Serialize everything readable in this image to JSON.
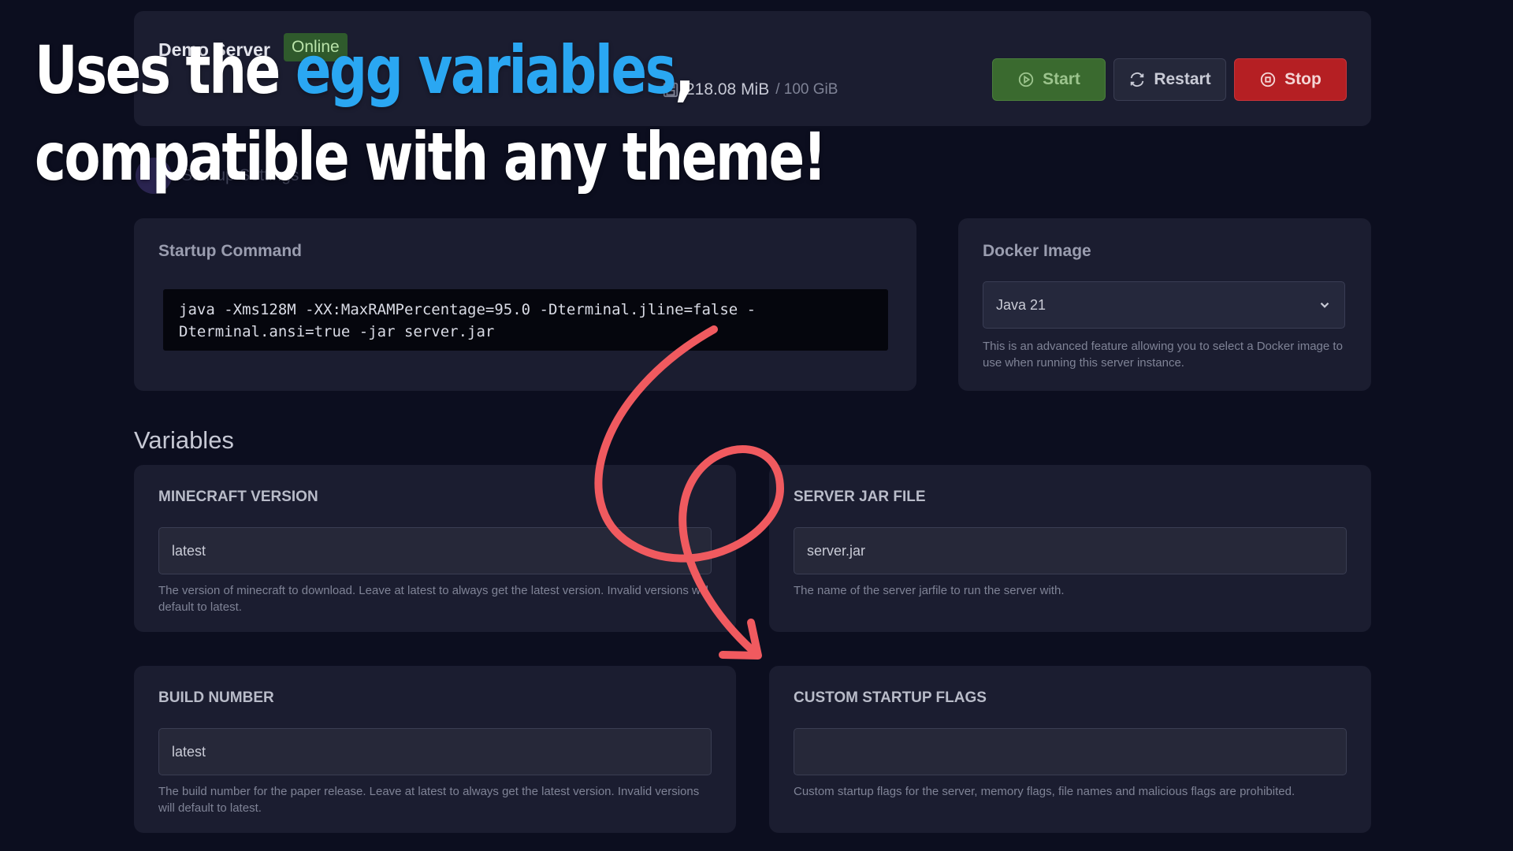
{
  "header": {
    "server_name": "Demo Server",
    "status": "Online",
    "disk_used": "218.08 MiB",
    "disk_limit": "/ 100 GiB",
    "buttons": {
      "start": "Start",
      "restart": "Restart",
      "stop": "Stop"
    },
    "colors": {
      "start": "#3a6a2f",
      "restart": "#25283a",
      "stop": "#b51f23",
      "status": "#2f5a2c"
    }
  },
  "tab": {
    "label": "Startup Settings"
  },
  "startup": {
    "title": "Startup Command",
    "command": "java -Xms128M -XX:MaxRAMPercentage=95.0 -Dterminal.jline=false -\nDterminal.ansi=true -jar server.jar"
  },
  "docker": {
    "title": "Docker Image",
    "selected": "Java 21",
    "help": "This is an advanced feature allowing you to select a Docker image to use when running this server instance."
  },
  "variables": {
    "heading": "Variables",
    "items": [
      {
        "title": "MINECRAFT VERSION",
        "value": "latest",
        "help": "The version of minecraft to download. Leave at latest to always get the latest version. Invalid versions will default to latest."
      },
      {
        "title": "SERVER JAR FILE",
        "value": "server.jar",
        "help": "The name of the server jarfile to run the server with."
      },
      {
        "title": "BUILD NUMBER",
        "value": "latest",
        "help": "The build number for the paper release. Leave at latest to always get the latest version. Invalid versions will default to latest."
      },
      {
        "title": "CUSTOM STARTUP FLAGS",
        "value": "",
        "help": "Custom startup flags for the server, memory flags, file names and malicious flags are prohibited."
      }
    ]
  },
  "overlay": {
    "line1_prefix": "Uses the ",
    "line1_accent": "egg variables",
    "line1_suffix": ",",
    "line2": "compatible with any theme!",
    "accent_color": "#2aa7f2",
    "arrow_color": "#f05a5f"
  }
}
